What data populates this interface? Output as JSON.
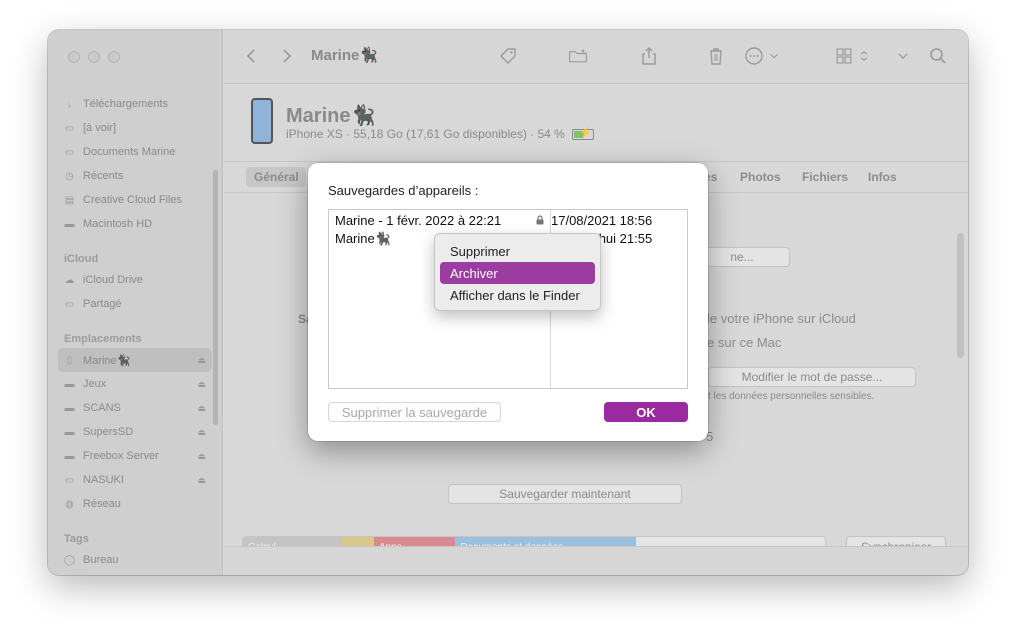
{
  "window": {
    "title": "Marine🐈‍⬛",
    "traffic_colors": [
      "#ff5f57",
      "#febc2e",
      "#28c840"
    ]
  },
  "sidebar": {
    "items_top": [
      {
        "label": "Téléchargements",
        "icon": "download-icon"
      },
      {
        "label": "[à voir]",
        "icon": "folder-icon"
      },
      {
        "label": "Documents Marine",
        "icon": "folder-icon"
      },
      {
        "label": "Récents",
        "icon": "clock-icon"
      },
      {
        "label": "Creative Cloud Files",
        "icon": "document-icon"
      },
      {
        "label": "Macintosh HD",
        "icon": "disk-icon"
      }
    ],
    "section_icloud": "iCloud",
    "items_icloud": [
      {
        "label": "iCloud Drive",
        "icon": "cloud-icon"
      },
      {
        "label": "Partagé",
        "icon": "shared-folder-icon"
      }
    ],
    "section_locations": "Emplacements",
    "items_locations": [
      {
        "label": "Marine🐈‍⬛",
        "icon": "phone-icon",
        "active": true,
        "eject": true
      },
      {
        "label": "Jeux",
        "icon": "disk-icon",
        "eject": true
      },
      {
        "label": "SCANS",
        "icon": "disk-icon",
        "eject": true
      },
      {
        "label": "SupersSD",
        "icon": "disk-icon",
        "eject": true
      },
      {
        "label": "Freebox Server",
        "icon": "disk-icon",
        "eject": true
      },
      {
        "label": "NASUKI",
        "icon": "monitor-icon",
        "eject": true
      },
      {
        "label": "Réseau",
        "icon": "globe-icon",
        "eject": false
      }
    ],
    "section_tags": "Tags",
    "items_tags": [
      {
        "label": "Bureau",
        "icon": "tag-icon"
      }
    ]
  },
  "device": {
    "name": "Marine🐈‍⬛",
    "subtitle": "iPhone XS · 55,18 Go (17,61 Go disponibles) · 54 %",
    "battery_percent": 54
  },
  "tabs": {
    "general": "Général",
    "partial_es": "es",
    "photos": "Photos",
    "files": "Fichiers",
    "info": "Infos"
  },
  "background": {
    "manage_btn_partial": "ne...",
    "icloud_text": "le votre iPhone sur iCloud",
    "mac_text": "e sur ce Mac",
    "change_password": "Modifier le mot de passe...",
    "sensitive_text": "t les données personnelles sensibles.",
    "partial_s": "Sa",
    "partial_5": "5",
    "backup_now": "Sauvegarder maintenant",
    "sync_btn": "Synchroniser"
  },
  "storage": {
    "segments": [
      {
        "label": "Calcul...",
        "color": "#c4c4c4",
        "fraction": 0.17
      },
      {
        "label": "",
        "color": "#d9c88a",
        "fraction": 0.055
      },
      {
        "label": "Apps",
        "color": "#d98a90",
        "fraction": 0.14
      },
      {
        "label": "Documents et données",
        "color": "#9cc0dc",
        "fraction": 0.31
      }
    ]
  },
  "dialog": {
    "title": "Sauvegardes d’appareils :",
    "rows": [
      {
        "name": "Marine - 1 févr. 2022 à 22:21",
        "date": "17/08/2021 18:56",
        "locked": true
      },
      {
        "name": "Marine🐈‍⬛",
        "date": "Aujourd’hui 21:55",
        "locked": false
      }
    ],
    "delete_backup": "Supprimer la sauvegarde",
    "ok": "OK",
    "accent": "#9b2aa0"
  },
  "context_menu": {
    "items": [
      "Supprimer",
      "Archiver",
      "Afficher dans le Finder"
    ],
    "selected_index": 1,
    "selected_color": "#9b3ca1"
  }
}
